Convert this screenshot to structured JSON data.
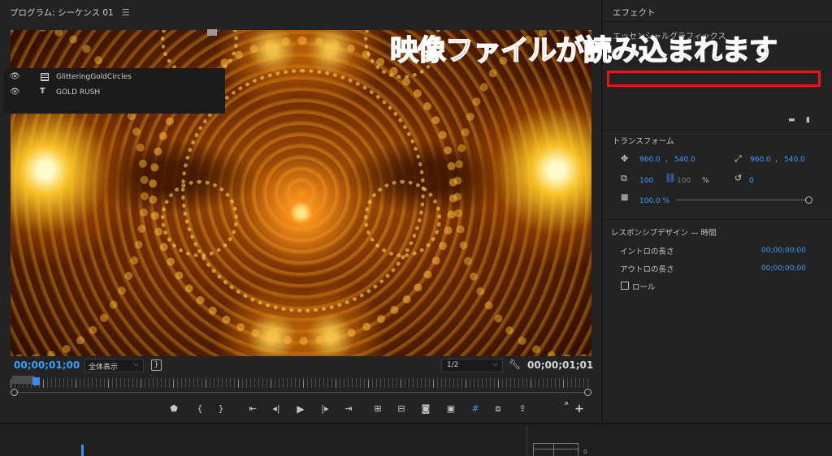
{
  "program": {
    "title": "プログラム: シーケンス 01",
    "menu_icon": "hamburger-menu-icon",
    "timecode_in": "00;00;01;00",
    "fit_select": "全体表示",
    "resolution_select": "1/2",
    "timecode_out": "00;00;01;01",
    "transport": {
      "marker": "marker-icon",
      "mark_in": "mark-in-icon",
      "mark_out": "mark-out-icon",
      "go_to_in": "go-to-in-icon",
      "step_back": "step-back-icon",
      "play": "play-icon",
      "step_forward": "step-forward-icon",
      "go_to_out": "go-to-out-icon",
      "lift": "lift-icon",
      "extract": "extract-icon",
      "export_frame": "camera-icon",
      "comparison": "comparison-view-icon",
      "safe_margins": "safe-margins-icon",
      "proxy": "proxy-toggle-icon",
      "export": "export-icon",
      "more": "chevron-double-right-icon",
      "add": "plus-icon"
    }
  },
  "annotation": {
    "text": "映像ファイルが読み込まれます",
    "color": "#ff2a2a"
  },
  "effects": {
    "title": "エフェクト",
    "essential_graphics_label": "エッセンシャルグラフィックス",
    "layers": [
      {
        "name": "GlitteringGoldCircles",
        "type": "video-clip-icon",
        "visible_icon": "eye-icon"
      },
      {
        "name": "GOLD RUSH",
        "type": "text-layer-icon",
        "type_glyph": "T",
        "visible_icon": "eye-icon"
      }
    ],
    "transform": {
      "title": "トランスフォーム",
      "position_x": "960.0",
      "position_y": "540.0",
      "anchor_x": "960.0",
      "anchor_y": "540.0",
      "scale": "100",
      "scale_locked_value": "100",
      "percent": "%",
      "rotation": "0",
      "opacity": "100.0 %"
    },
    "responsive": {
      "title": "レスポンシブデザイン — 時間",
      "intro_label": "イントロの長さ",
      "intro_value": "00;00;00;00",
      "outro_label": "アウトロの長さ",
      "outro_value": "00;00;00;00",
      "roll_label": "ロール",
      "roll_checked": false
    }
  },
  "bottom": {
    "meter_zero": "0"
  },
  "colors": {
    "accent_blue": "#3a9cff",
    "highlight_red": "#e51717",
    "panel_bg": "#232323"
  }
}
